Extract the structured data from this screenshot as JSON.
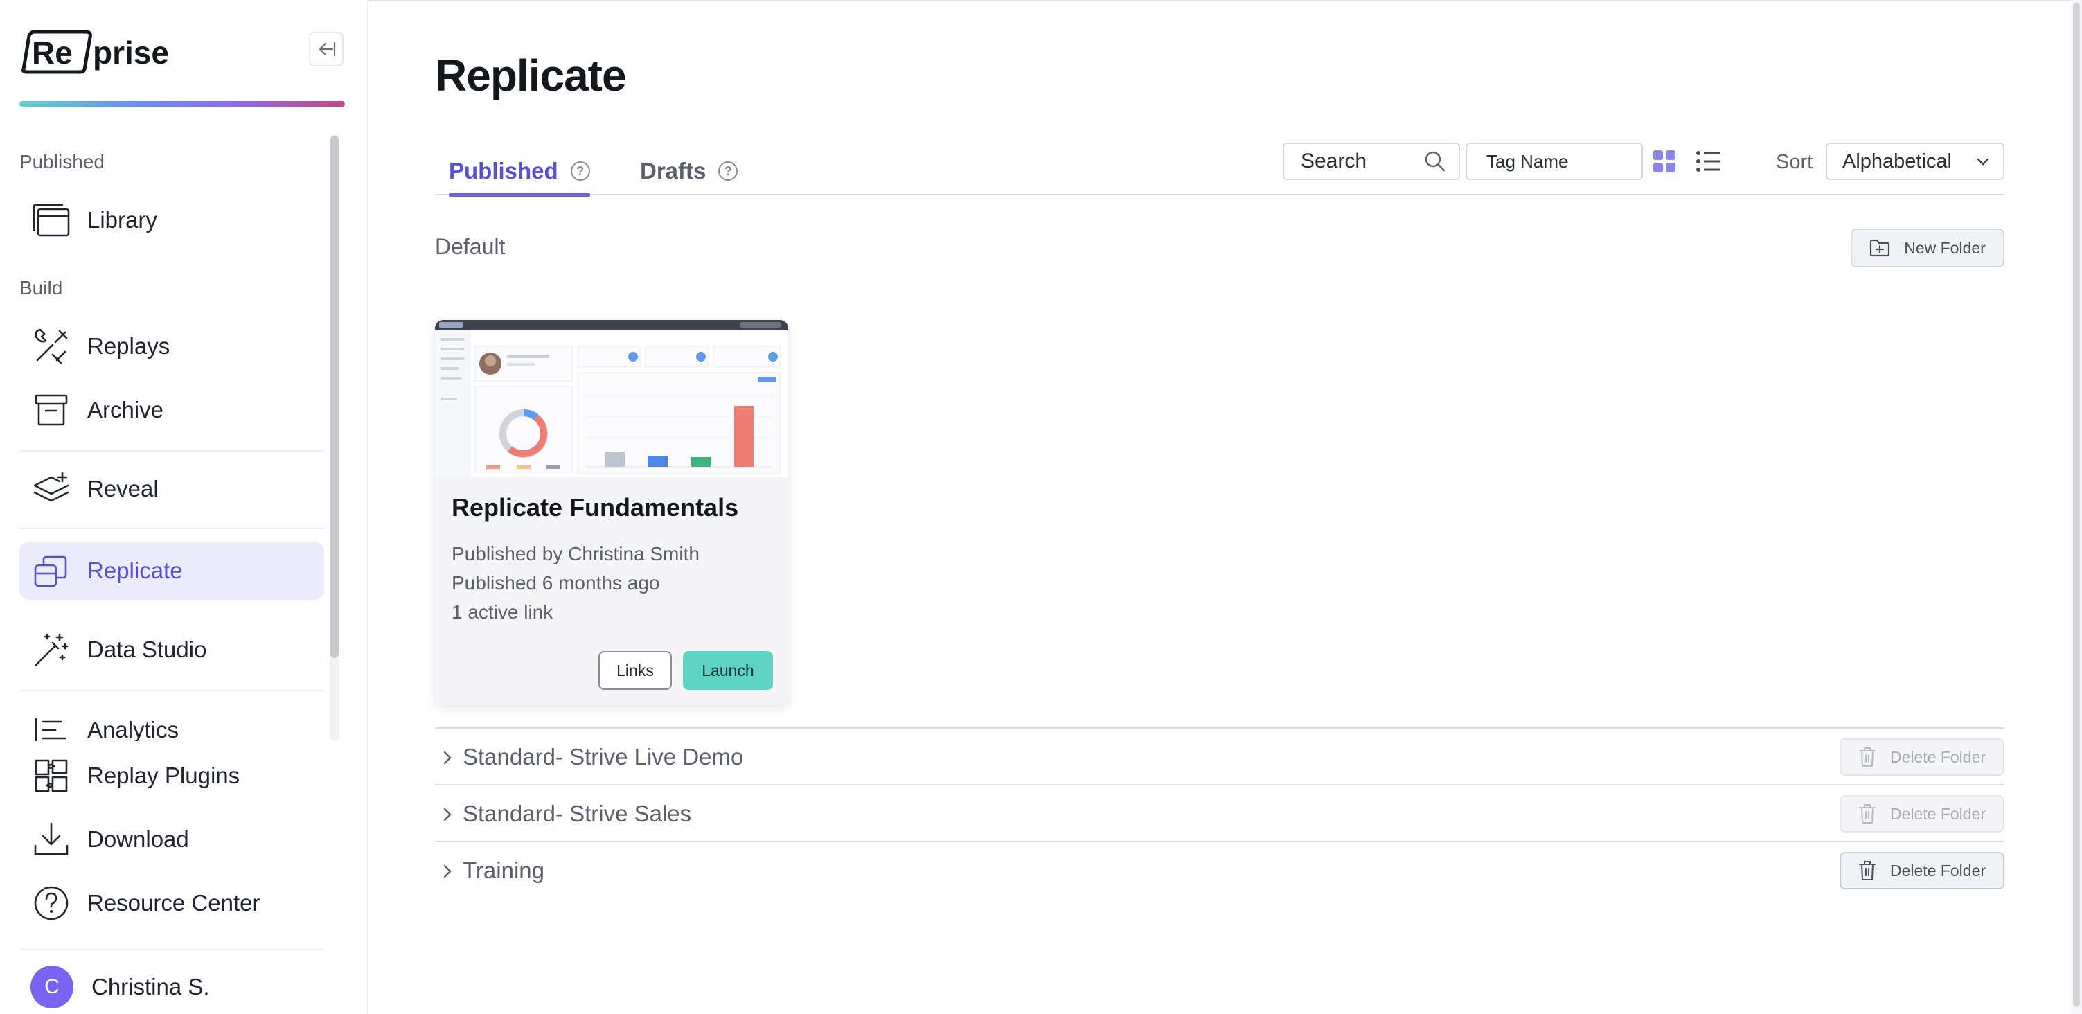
{
  "app": {
    "logo_text": "Re/prise"
  },
  "sidebar": {
    "sections": {
      "published": "Published",
      "build": "Build"
    },
    "items": [
      {
        "label": "Library",
        "icon": "library-icon"
      },
      {
        "label": "Replays",
        "icon": "tools-icon"
      },
      {
        "label": "Archive",
        "icon": "archive-icon"
      },
      {
        "label": "Reveal",
        "icon": "layers-icon"
      },
      {
        "label": "Replicate",
        "icon": "replicate-icon",
        "active": true
      },
      {
        "label": "Data Studio",
        "icon": "magic-wand-icon"
      },
      {
        "label": "Analytics",
        "icon": "analytics-icon"
      }
    ],
    "bottom_items": [
      {
        "label": "Replay Plugins",
        "icon": "puzzle-icon"
      },
      {
        "label": "Download",
        "icon": "download-icon"
      },
      {
        "label": "Resource Center",
        "icon": "help-circle-icon"
      }
    ],
    "user": {
      "initial": "C",
      "name": "Christina S."
    }
  },
  "main": {
    "title": "Replicate",
    "tabs": [
      {
        "label": "Published",
        "active": true
      },
      {
        "label": "Drafts",
        "active": false
      }
    ],
    "search": {
      "placeholder": "Search"
    },
    "tag_filter": {
      "placeholder": "Tag Name"
    },
    "sort": {
      "label": "Sort",
      "value": "Alphabetical"
    },
    "default_folder": {
      "name": "Default",
      "new_folder_label": "New Folder",
      "cards": [
        {
          "title": "Replicate Fundamentals",
          "published_by": "Published by Christina Smith",
          "published_when": "Published 6 months ago",
          "active_links": "1 active link",
          "links_label": "Links",
          "launch_label": "Launch"
        }
      ]
    },
    "folders": [
      {
        "name": "Standard- Strive Live Demo",
        "delete_label": "Delete Folder",
        "delete_enabled": false
      },
      {
        "name": "Standard- Strive Sales",
        "delete_label": "Delete Folder",
        "delete_enabled": false
      },
      {
        "name": "Training",
        "delete_label": "Delete Folder",
        "delete_enabled": true
      }
    ]
  },
  "colors": {
    "accent": "#5a4fd0",
    "launch": "#5fd4c4",
    "active_nav_bg": "#ecebfb",
    "avatar": "#7a63f0"
  }
}
